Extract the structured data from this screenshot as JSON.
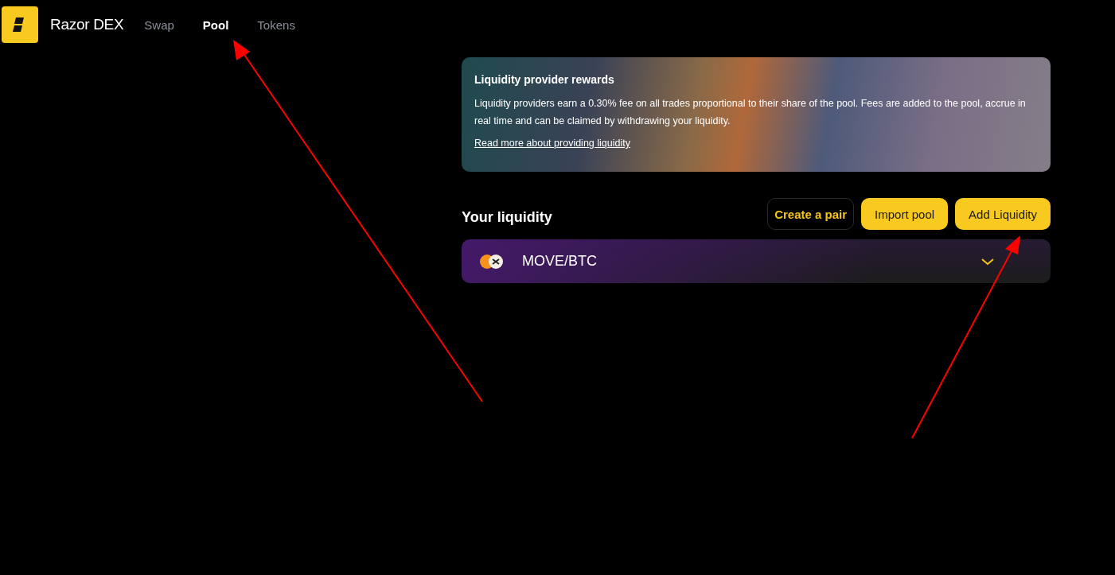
{
  "header": {
    "brand": "Razor DEX",
    "nav": [
      {
        "label": "Swap",
        "selected": false
      },
      {
        "label": "Pool",
        "selected": true
      },
      {
        "label": "Tokens",
        "selected": false
      }
    ]
  },
  "banner": {
    "title": "Liquidity provider rewards",
    "text": "Liquidity providers earn a 0.30% fee on all trades proportional to their share of the pool. Fees are added to the pool, accrue in real time and can be claimed by withdrawing your liquidity.",
    "link": "Read more about providing liquidity"
  },
  "liquidity": {
    "title": "Your liquidity",
    "buttons": [
      {
        "label": "Create a pair",
        "kind": "outline"
      },
      {
        "label": "Import pool",
        "kind": "filled"
      },
      {
        "label": "Add Liquidity",
        "kind": "filled"
      }
    ],
    "pools": [
      {
        "pair": "MOVE/BTC",
        "expanded": false
      }
    ]
  }
}
